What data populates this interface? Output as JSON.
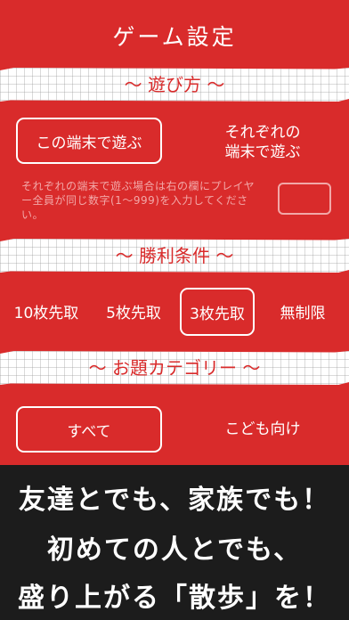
{
  "header": {
    "title": "ゲーム設定"
  },
  "play_mode": {
    "section_label": "～ 遊び方 ～",
    "option_single": "この端末で遊ぶ",
    "option_multi_line1": "それぞれの",
    "option_multi_line2": "端末で遊ぶ",
    "note": "それぞれの端末で遊ぶ場合は右の欄にプレイヤー全員が同じ数字(1〜999)を入力してください。",
    "number_input_value": ""
  },
  "win_condition": {
    "section_label": "～ 勝利条件 ～",
    "options": [
      "10枚先取",
      "5枚先取",
      "3枚先取",
      "無制限"
    ],
    "selected": "3枚先取"
  },
  "category": {
    "section_label": "～ お題カテゴリー ～",
    "options": [
      "すべて",
      "こども向け"
    ],
    "selected": "すべて"
  },
  "banner": {
    "line1": "友達とでも、家族でも！",
    "line2": "初めての人とでも、",
    "line3": "盛り上がる「散歩」を！"
  },
  "colors": {
    "background": "#d92b2b",
    "tape": "#ffffff",
    "banner": "#1c1c1c"
  }
}
